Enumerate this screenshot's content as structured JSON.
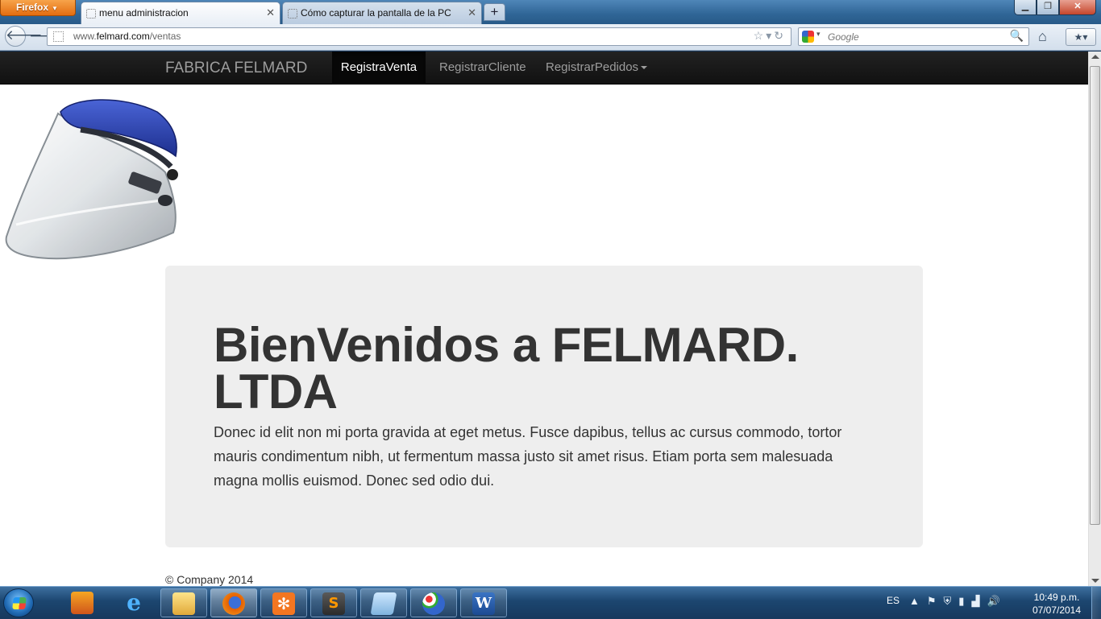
{
  "browser": {
    "app_button": "Firefox",
    "tabs": [
      {
        "title": "menu administracion",
        "active": true
      },
      {
        "title": "Cómo capturar la pantalla de la PC",
        "active": false
      }
    ],
    "url": {
      "prefix": "www.",
      "host": "felmard.com",
      "path": "/ventas"
    },
    "search_placeholder": "Google"
  },
  "site": {
    "brand": "FABRICA FELMARD",
    "nav": [
      {
        "label": "RegistraVenta",
        "active": true
      },
      {
        "label": "RegistrarCliente",
        "active": false
      },
      {
        "label": "RegistrarPedidos",
        "active": false,
        "dropdown": true
      }
    ],
    "jumbotron": {
      "title": "BienVenidos a FELMARD. LTDA",
      "text": "Donec id elit non mi porta gravida at eget metus. Fusce dapibus, tellus ac cursus commodo, tortor mauris condimentum nibh, ut fermentum massa justo sit amet risus. Etiam porta sem malesuada magna mollis euismod. Donec sed odio dui."
    },
    "footer": "© Company 2014"
  },
  "taskbar": {
    "pinned": [
      "media-player-icon",
      "internet-explorer-icon",
      "file-explorer-icon",
      "firefox-icon",
      "xampp-icon",
      "sublime-text-icon",
      "notepad-icon",
      "paint-icon",
      "word-icon"
    ],
    "language": "ES",
    "time": "10:49 p.m.",
    "date": "07/07/2014"
  },
  "colors": {
    "navbar_bg": "#222222",
    "jumbotron_bg": "#eeeeee",
    "firefox_orange": "#e66000",
    "taskbar_blue": "#1c4670"
  }
}
